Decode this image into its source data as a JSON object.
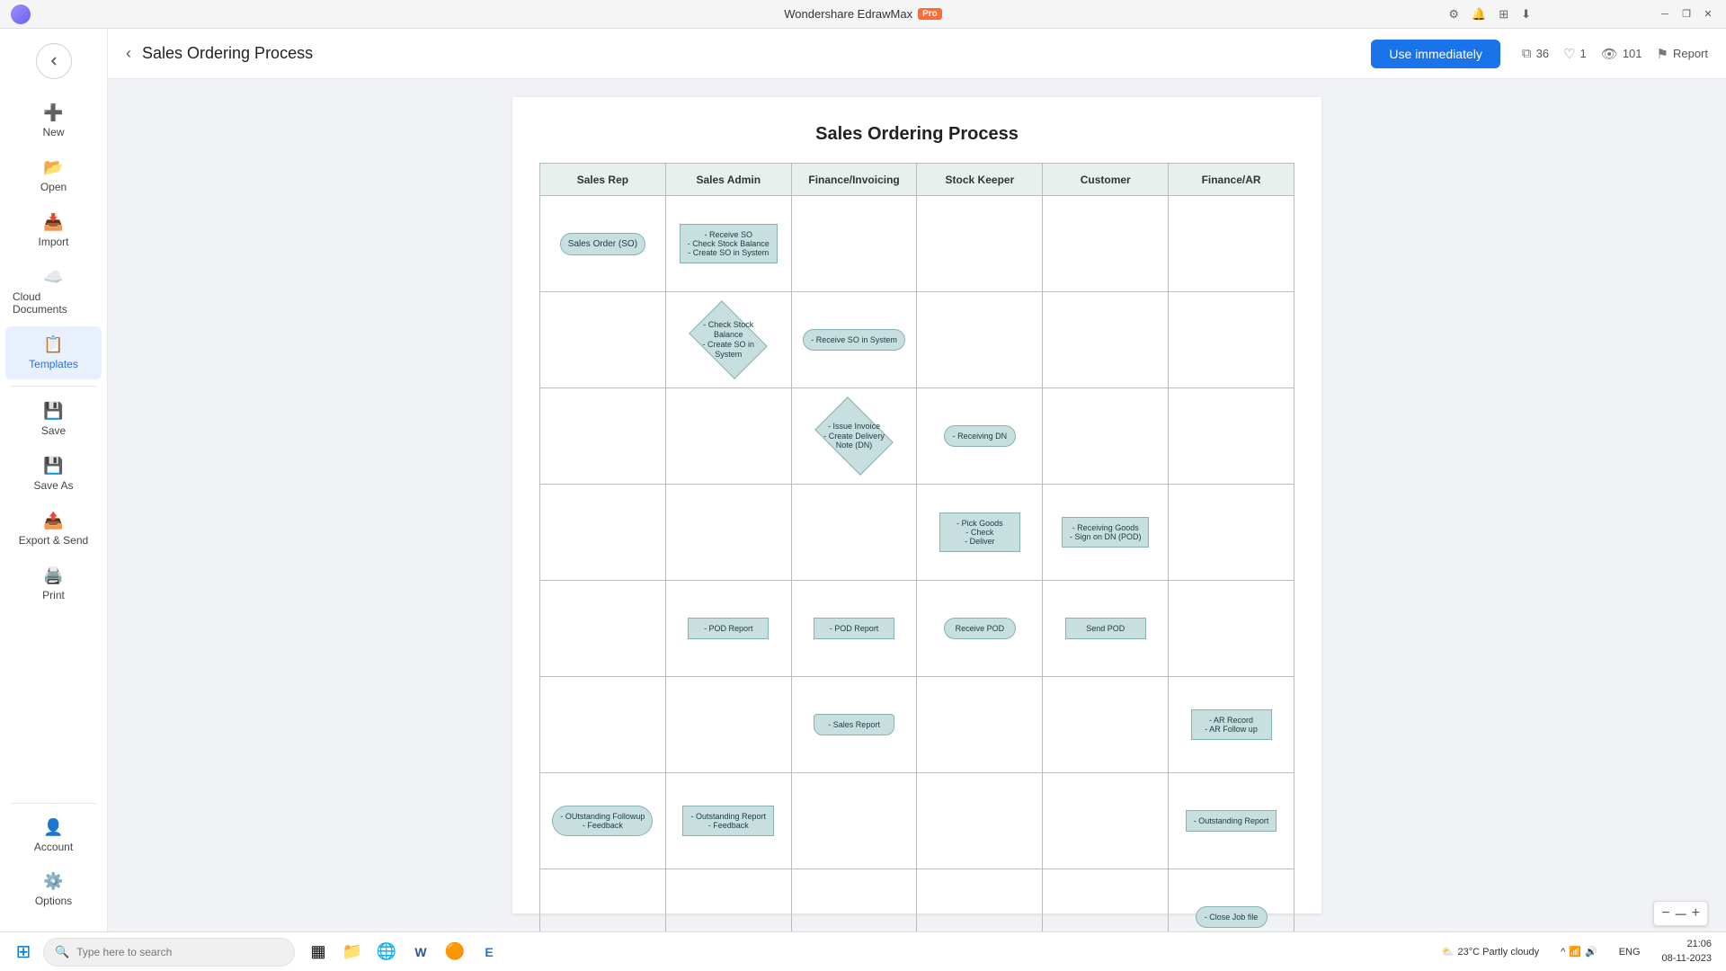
{
  "titlebar": {
    "title": "Wondershare EdrawMax",
    "pro_label": "Pro",
    "controls": [
      "minimize",
      "restore",
      "close"
    ]
  },
  "sidebar": {
    "back_tooltip": "Back",
    "items": [
      {
        "id": "new",
        "label": "New",
        "icon": "➕"
      },
      {
        "id": "open",
        "label": "Open",
        "icon": "📂"
      },
      {
        "id": "import",
        "label": "Import",
        "icon": "📥"
      },
      {
        "id": "cloud",
        "label": "Cloud Documents",
        "icon": "☁️"
      },
      {
        "id": "templates",
        "label": "Templates",
        "icon": "📋"
      },
      {
        "id": "save",
        "label": "Save",
        "icon": "💾"
      },
      {
        "id": "saveas",
        "label": "Save As",
        "icon": "💾"
      },
      {
        "id": "export",
        "label": "Export & Send",
        "icon": "📤"
      },
      {
        "id": "print",
        "label": "Print",
        "icon": "🖨️"
      }
    ],
    "bottom_items": [
      {
        "id": "account",
        "label": "Account",
        "icon": "👤"
      },
      {
        "id": "options",
        "label": "Options",
        "icon": "⚙️"
      }
    ]
  },
  "header": {
    "back_label": "‹",
    "title": "Sales Ordering Process",
    "use_btn": "Use immediately",
    "stats": [
      {
        "icon": "⧉",
        "value": "36"
      },
      {
        "icon": "♡",
        "value": "1"
      },
      {
        "icon": "👁",
        "value": "101"
      }
    ],
    "report_label": "Report"
  },
  "diagram": {
    "title": "Sales Ordering Process",
    "columns": [
      "Sales Rep",
      "Sales Admin",
      "Finance/Invoicing",
      "Stock Keeper",
      "Customer",
      "Finance/AR"
    ],
    "nodes": {
      "sales_order": "Sales Order (SO)",
      "receive_so": "- Receive SO\n- Check Stock Balance\n- Create SO in System",
      "check_stock": "- Check Stock\nBalance\n- Create SO in\nSystem",
      "receive_so_sys": "- Receive SO in System",
      "issue_invoice": "- Issue Invoice\n- Create Delivery\nNote (DN)",
      "receiving_dn": "- Receiving DN",
      "pick_goods": "- Pick Goods\n- Check\n- Deliver",
      "receiving_goods": "- Receiving Goods\n- Sign on DN (POD)",
      "pod_report_admin": "- POD Report",
      "pod_report_finance": "- POD Report",
      "receive_pod": "Receive POD",
      "send_pod": "Send POD",
      "sales_report": "- Sales Report",
      "ar_record": "- AR Record\n- AR Follow up",
      "outstanding_rep_sales": "- OUtstanding Followup\n- Feedback",
      "outstanding_rep_admin": "- Outstanding Report\n- Feedback",
      "outstanding_rep_ar": "- Outstanding Report",
      "close_job": "- Close Job file"
    }
  },
  "zoom": {
    "minus": "−",
    "indicator": "—",
    "plus": "+"
  },
  "taskbar": {
    "search_placeholder": "Type here to search",
    "apps": [
      "⊞",
      "🔍",
      "▦",
      "📁",
      "🌐",
      "📝",
      "🔵",
      "🟠"
    ],
    "sys_info": "23°C  Partly cloudy",
    "time": "21:06",
    "date": "08-11-2023",
    "language": "ENG"
  }
}
